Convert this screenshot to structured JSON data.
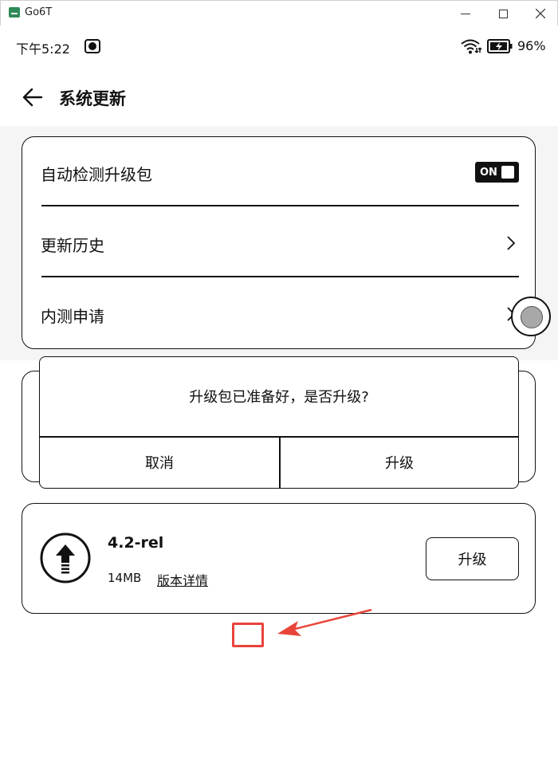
{
  "window": {
    "title": "Go6T"
  },
  "status": {
    "time": "下午5:22",
    "battery_pct": "96%"
  },
  "header": {
    "title": "系统更新"
  },
  "settings": {
    "auto_check_label": "自动检测升级包",
    "toggle_label": "ON",
    "history_label": "更新历史",
    "beta_label": "内测申请"
  },
  "dialog": {
    "message": "升级包已准备好，是否升级?",
    "cancel_label": "取消",
    "confirm_label": "升级"
  },
  "package": {
    "version": "4.2-rel",
    "size": "14MB",
    "details_label": "版本详情",
    "upgrade_label": "升级"
  },
  "colors": {
    "annotation": "#e8443a",
    "accent": "#111111"
  }
}
